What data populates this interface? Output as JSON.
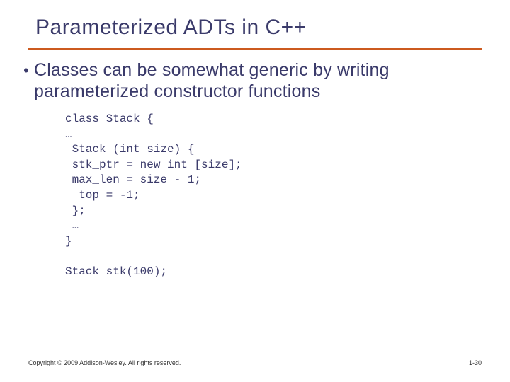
{
  "title": "Parameterized ADTs in C++",
  "bullet": "Classes can be somewhat generic by writing parameterized constructor functions",
  "code": "class Stack {\n…\n Stack (int size) {\n stk_ptr = new int [size];\n max_len = size - 1;\n  top = -1;\n };\n …\n}\n\nStack stk(100);",
  "footer": "Copyright © 2009 Addison-Wesley. All rights reserved.",
  "pagenum": "1-30"
}
